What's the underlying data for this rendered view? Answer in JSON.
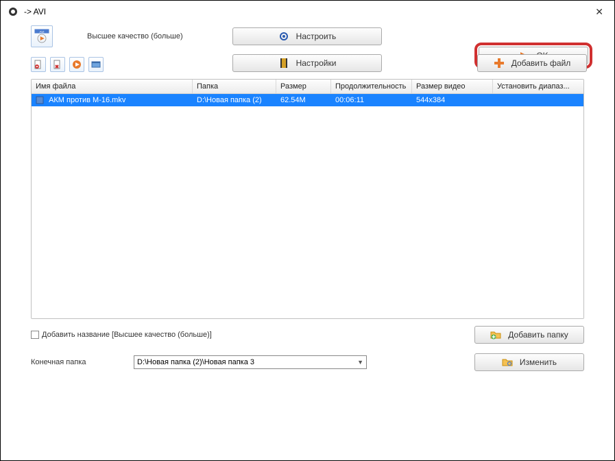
{
  "title": "-> AVI",
  "toolbar": {
    "quality_label": "Высшее качество (больше)",
    "configure_label": "Настроить",
    "settings_label": "Настройки",
    "ok_label": "OK",
    "add_file_label": "Добавить файл"
  },
  "table": {
    "headers": {
      "name": "Имя файла",
      "folder": "Папка",
      "size": "Размер",
      "duration": "Продолжительность",
      "video_size": "Размер видео",
      "range": "Установить диапаз..."
    },
    "rows": [
      {
        "name": "АКМ против М-16.mkv",
        "folder": "D:\\Новая папка (2)",
        "size": "62.54M",
        "duration": "00:06:11",
        "video_size": "544x384",
        "range": ""
      }
    ]
  },
  "bottom": {
    "add_name_label": "Добавить название [Высшее качество (больше)]",
    "add_folder_label": "Добавить папку",
    "dest_label": "Конечная папка",
    "dest_value": "D:\\Новая папка (2)\\Новая папка 3",
    "change_label": "Изменить"
  }
}
